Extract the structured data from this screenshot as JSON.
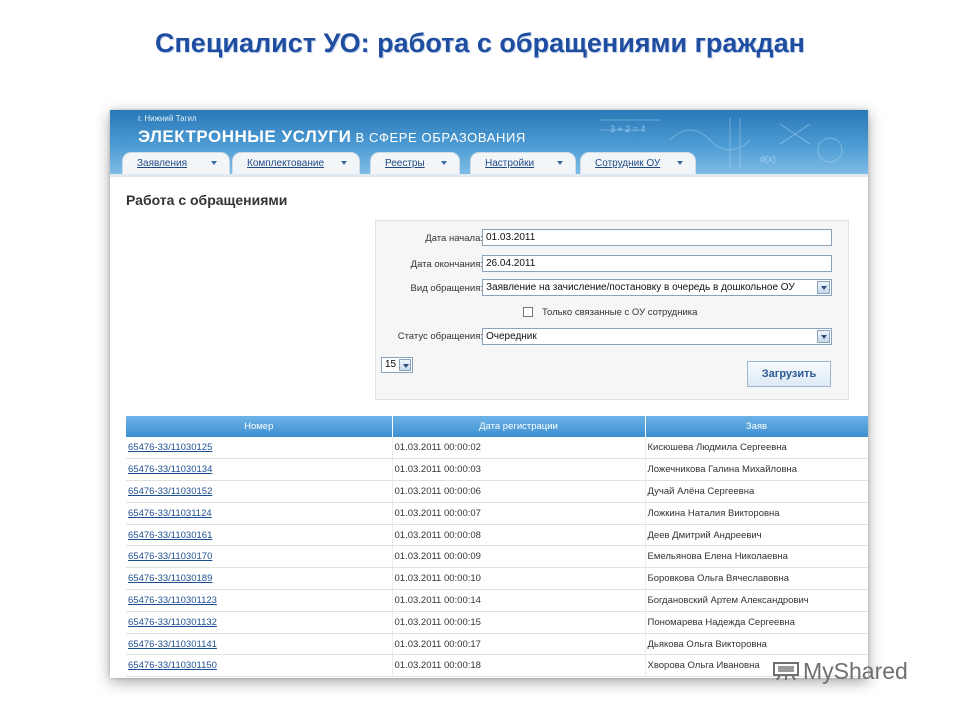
{
  "slide": {
    "title": "Специалист УО: работа с обращениями граждан"
  },
  "header": {
    "city": "г. Нижний Тагил",
    "brand_big": "ЭЛЕКТРОННЫЕ УСЛУГИ",
    "brand_small": " В СФЕРЕ ОБРАЗОВАНИЯ",
    "tabs": [
      {
        "label": "Заявления"
      },
      {
        "label": "Комплектование"
      },
      {
        "label": "Реестры"
      },
      {
        "label": "Настройки"
      },
      {
        "label": "Сотрудник ОУ"
      }
    ]
  },
  "page": {
    "title": "Работа с обращениями"
  },
  "filter": {
    "start_label": "Дата начала:",
    "start_value": "01.03.2011",
    "end_label": "Дата окончания:",
    "end_value": "26.04.2011",
    "type_label": "Вид обращения:",
    "type_value": "Заявление на зачисление/постановку в очередь в дошкольное ОУ",
    "only_related_label": "Только связанные с ОУ сотрудника",
    "status_label": "Статус обращения:",
    "status_value": "Очередник",
    "per_page": "15",
    "load_button": "Загрузить"
  },
  "table": {
    "columns": [
      "Номер",
      "Дата регистрации",
      "Заяв"
    ],
    "rows": [
      [
        "65476-33/11030125",
        "01.03.2011 00:00:02",
        "Кисюшева Людмила Сергеевна"
      ],
      [
        "65476-33/11030134",
        "01.03.2011 00:00:03",
        "Ложечникова Галина Михайловна"
      ],
      [
        "65476-33/11030152",
        "01.03.2011 00:00:06",
        "Дучай Алёна Сергеевна"
      ],
      [
        "65476-33/11031124",
        "01.03.2011 00:00:07",
        "Ложкина Наталия Викторовна"
      ],
      [
        "65476-33/11030161",
        "01.03.2011 00:00:08",
        "Деев Дмитрий Андреевич"
      ],
      [
        "65476-33/11030170",
        "01.03.2011 00:00:09",
        "Емельянова Елена Николаевна"
      ],
      [
        "65476-33/11030189",
        "01.03.2011 00:00:10",
        "Боровкова Ольга Вячеславовна"
      ],
      [
        "65476-33/110301123",
        "01.03.2011 00:00:14",
        "Богдановский Артем Александрович"
      ],
      [
        "65476-33/110301132",
        "01.03.2011 00:00:15",
        "Пономарева Надежда Сергеевна"
      ],
      [
        "65476-33/110301141",
        "01.03.2011 00:00:17",
        "Дьякова Ольга Викторовна"
      ],
      [
        "65476-33/110301150",
        "01.03.2011 00:00:18",
        "Хворова Ольга Ивановна"
      ]
    ]
  },
  "watermark": {
    "text": "MyShared"
  }
}
